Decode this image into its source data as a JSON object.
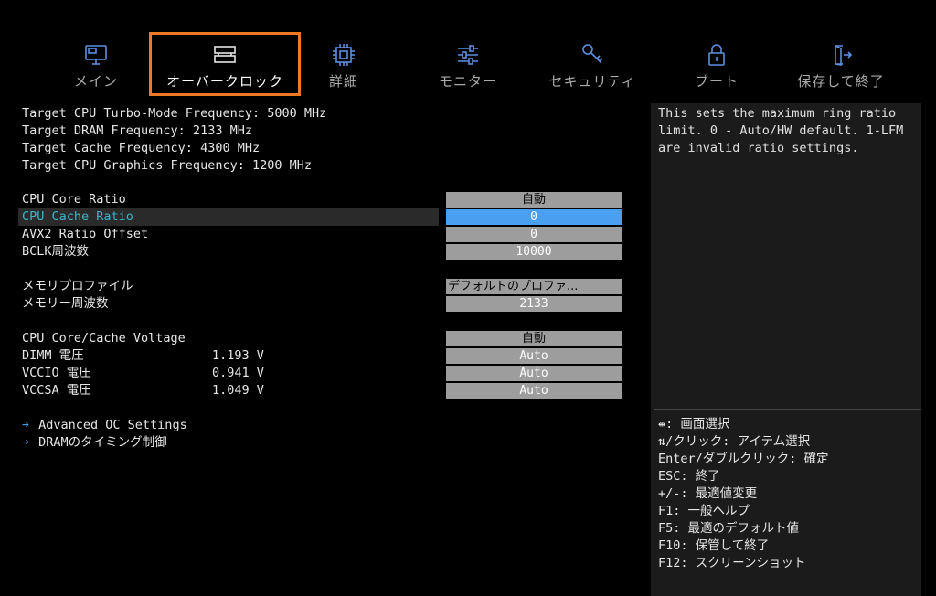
{
  "nav": {
    "tabs": [
      {
        "label": "メイン",
        "icon": "monitor-icon"
      },
      {
        "label": "オーバークロック",
        "icon": "memory-module-icon"
      },
      {
        "label": "詳細",
        "icon": "cpu-chip-icon"
      },
      {
        "label": "モニター",
        "icon": "sliders-icon"
      },
      {
        "label": "セキュリティ",
        "icon": "key-icon"
      },
      {
        "label": "ブート",
        "icon": "lock-icon"
      },
      {
        "label": "保存して終了",
        "icon": "exit-door-icon"
      }
    ],
    "active_tab": "オーバークロック",
    "highlight_color": "#f07a24"
  },
  "info": [
    "Target CPU Turbo-Mode Frequency: 5000 MHz",
    "Target DRAM Frequency: 2133 MHz",
    "Target Cache Frequency: 4300 MHz",
    "Target CPU Graphics Frequency: 1200 MHz"
  ],
  "settings": {
    "cpu_core_ratio": {
      "label": "CPU Core Ratio",
      "value": "自動"
    },
    "cpu_cache_ratio": {
      "label": "CPU Cache Ratio",
      "value": "0"
    },
    "avx2_ratio_offset": {
      "label": "AVX2 Ratio Offset",
      "value": "0"
    },
    "bclk": {
      "label": "BCLK周波数",
      "value": "10000"
    },
    "memory_profile": {
      "label": "メモリプロファイル",
      "value": "デフォルトのプロファ..."
    },
    "memory_frequency": {
      "label": "メモリー周波数",
      "value": "2133"
    },
    "core_cache_voltage": {
      "label": "CPU Core/Cache Voltage",
      "value": "自動"
    },
    "dimm_voltage": {
      "label": "DIMM 電圧",
      "reading": "1.193 V",
      "value": "Auto"
    },
    "vccio_voltage": {
      "label": "VCCIO 電圧",
      "reading": "0.941 V",
      "value": "Auto"
    },
    "vccsa_voltage": {
      "label": "VCCSA 電圧",
      "reading": "1.049 V",
      "value": "Auto"
    }
  },
  "links": [
    {
      "arrow": "➔",
      "label": "Advanced OC Settings"
    },
    {
      "arrow": "➔",
      "label": "DRAMのタイミング制御"
    }
  ],
  "help": {
    "description": "This sets the maximum ring ratio limit. 0 - Auto/HW default. 1-LFM are invalid ratio settings.",
    "keys": [
      "⇹: 画面選択",
      "⇅/クリック: アイテム選択",
      "Enter/ダブルクリック: 確定",
      "ESC: 終了",
      "+/-: 最適値変更",
      "F1: 一般ヘルプ",
      "F5: 最適のデフォルト値",
      "F10: 保管して終了",
      "F12: スクリーンショット"
    ]
  },
  "colors": {
    "accent_blue": "#4aa0f0",
    "selected_text": "#38b6c8",
    "value_box": "#9d9d9d",
    "icon_blue": "#5b8fe0"
  }
}
